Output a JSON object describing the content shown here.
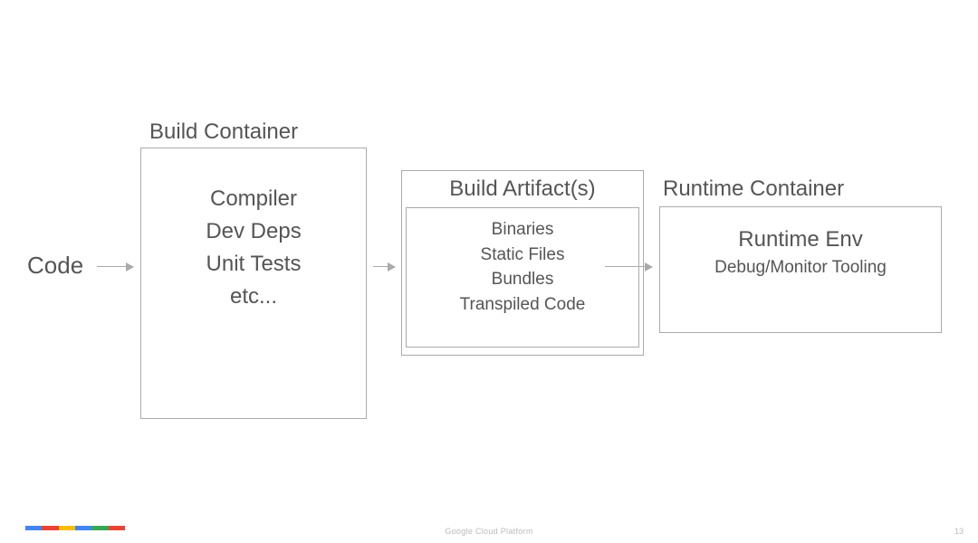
{
  "diagram": {
    "code_label": "Code",
    "build_container": {
      "title": "Build Container",
      "line1": "Compiler",
      "line2": "Dev Deps",
      "line3": "Unit Tests",
      "line4": "etc..."
    },
    "artifacts": {
      "title": "Build Artifact(s)",
      "line1": "Binaries",
      "line2": "Static Files",
      "line3": "Bundles",
      "line4": "Transpiled Code"
    },
    "runtime": {
      "title": "Runtime Container",
      "env": "Runtime Env",
      "sub": "Debug/Monitor Tooling"
    }
  },
  "footer": {
    "text": "Google Cloud Platform",
    "page": "13"
  }
}
